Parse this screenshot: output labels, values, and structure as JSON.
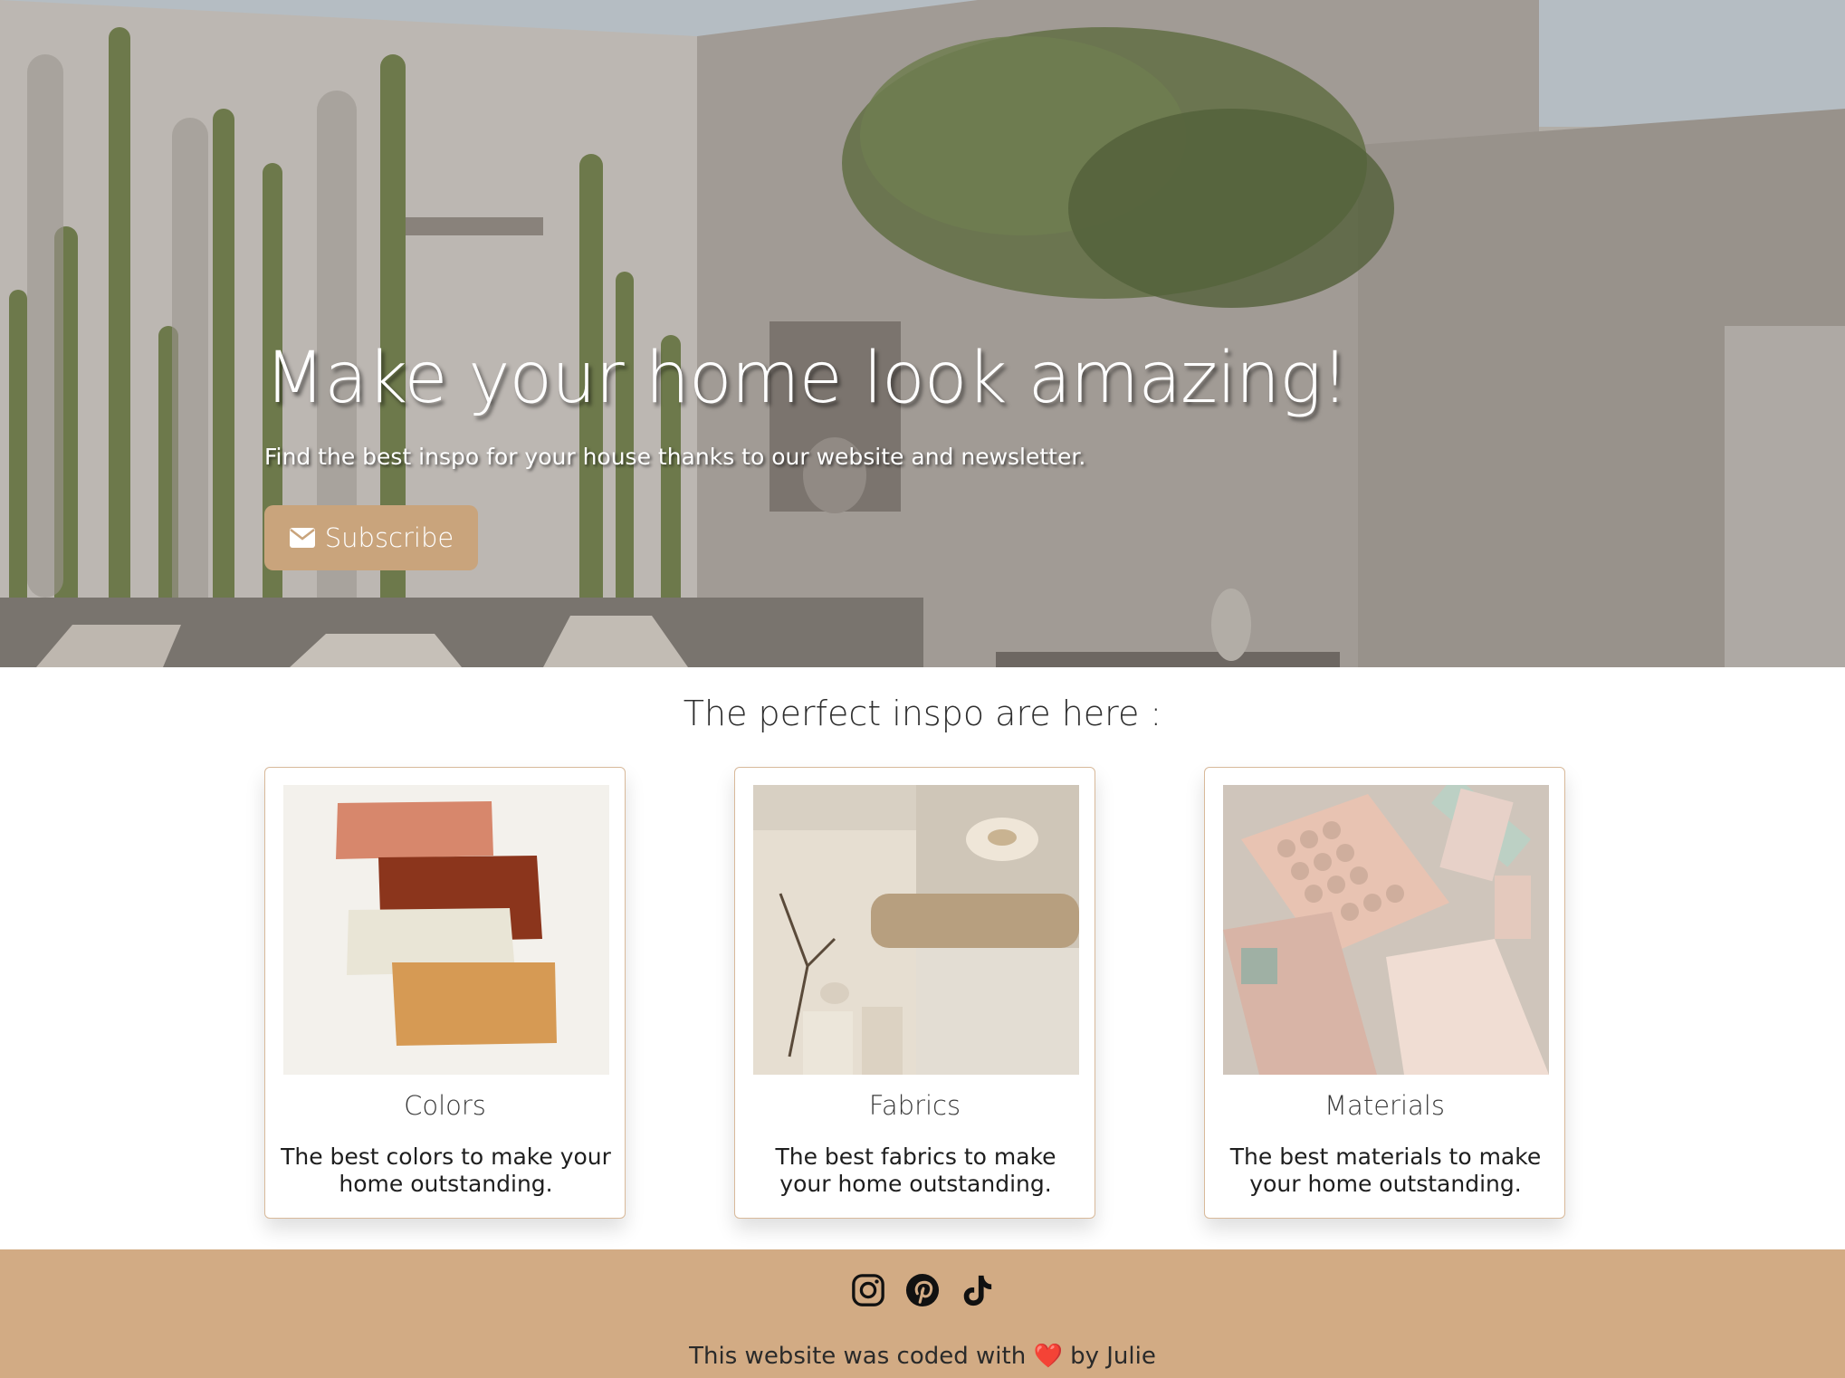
{
  "hero": {
    "title": "Make your home look amazing!",
    "subtitle": "Find the best inspo for your house thanks to our website and newsletter.",
    "subscribe_label": "Subscribe",
    "subscribe_icon": "envelope-icon"
  },
  "section": {
    "title": "The perfect inspo are here :"
  },
  "cards": [
    {
      "title": "Colors",
      "text": "The best colors to make your home outstanding.",
      "image": "paint-swatches"
    },
    {
      "title": "Fabrics",
      "text": "The best fabrics to make your home outstanding.",
      "image": "fabric-textures"
    },
    {
      "title": "Materials",
      "text": "The best materials to make your home outstanding.",
      "image": "tile-samples"
    }
  ],
  "footer": {
    "social_icons": [
      "instagram-icon",
      "pinterest-icon",
      "tiktok-icon"
    ],
    "text_before": "This website was coded with",
    "heart": "❤️",
    "text_after": "by Julie"
  },
  "colors": {
    "accent": "#d2ab84",
    "button": "#c9a47c",
    "card_border": "#d8b99a"
  }
}
